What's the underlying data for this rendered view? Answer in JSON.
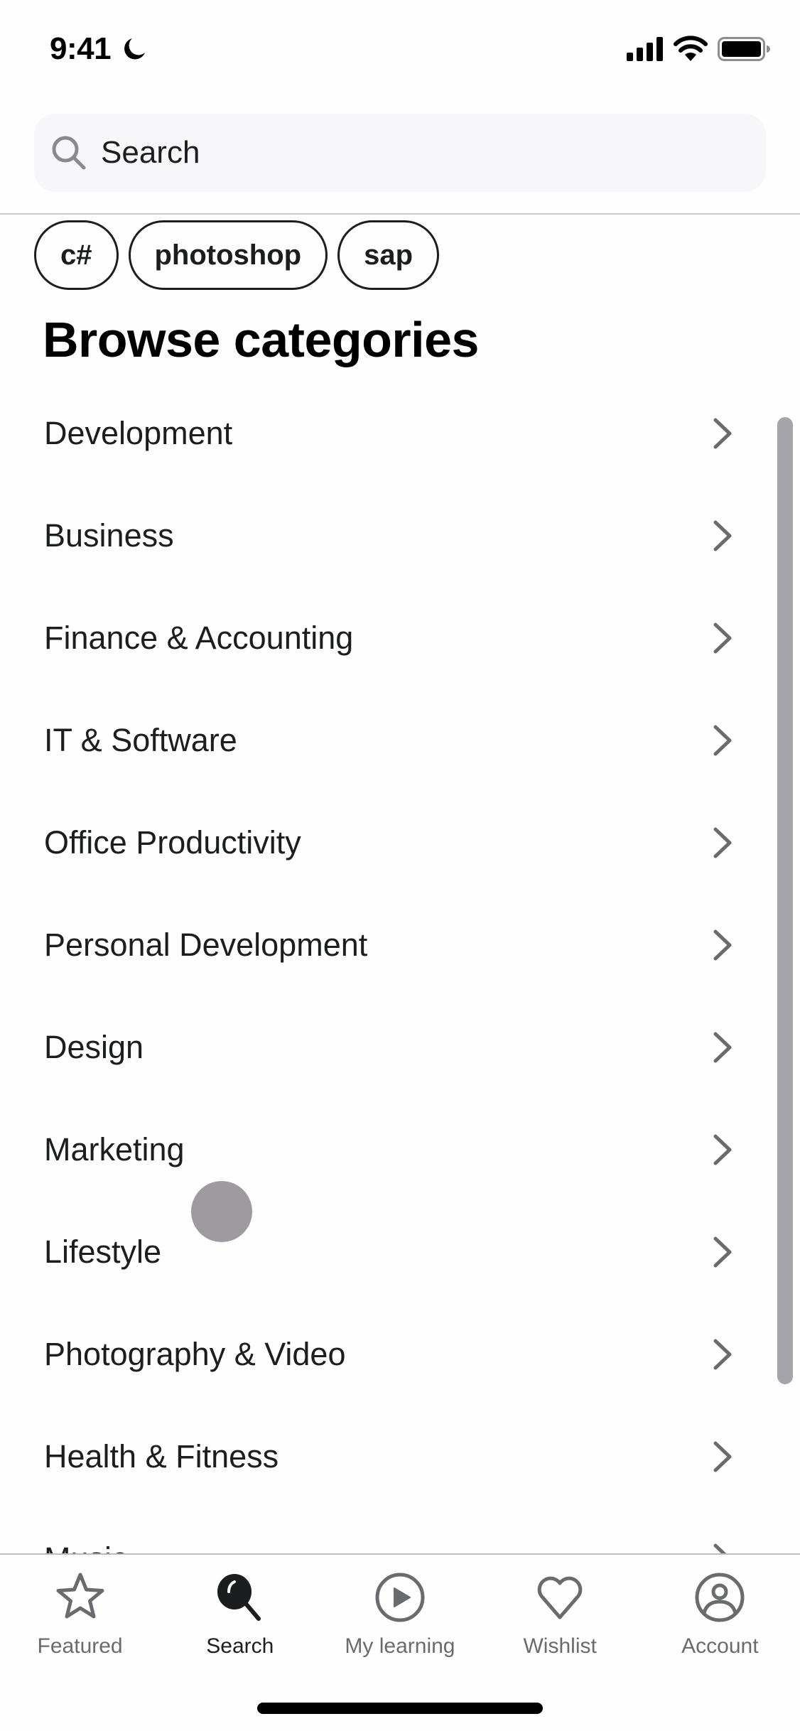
{
  "status_bar": {
    "time": "9:41",
    "icons": [
      "moon-icon",
      "cellular-signal-icon",
      "wifi-icon",
      "battery-icon"
    ]
  },
  "search": {
    "placeholder": "Search",
    "value": "",
    "icon": "search-icon"
  },
  "recent_searches": [
    "c#",
    "photoshop",
    "sap"
  ],
  "browse": {
    "title": "Browse categories",
    "categories": [
      "Development",
      "Business",
      "Finance & Accounting",
      "IT & Software",
      "Office Productivity",
      "Personal Development",
      "Design",
      "Marketing",
      "Lifestyle",
      "Photography & Video",
      "Health & Fitness",
      "Music"
    ],
    "row_icon": "chevron-right-icon"
  },
  "tab_bar": {
    "active": "Search",
    "tabs": [
      {
        "label": "Featured",
        "icon": "star-icon"
      },
      {
        "label": "Search",
        "icon": "search-icon"
      },
      {
        "label": "My learning",
        "icon": "play-circle-icon"
      },
      {
        "label": "Wishlist",
        "icon": "heart-icon"
      },
      {
        "label": "Account",
        "icon": "account-circle-icon"
      }
    ]
  },
  "colors": {
    "text": "#1c1d1f",
    "muted": "#6a6b6e",
    "search_bg": "#f7f7f9",
    "scrollbar": "#a5a4a8"
  }
}
